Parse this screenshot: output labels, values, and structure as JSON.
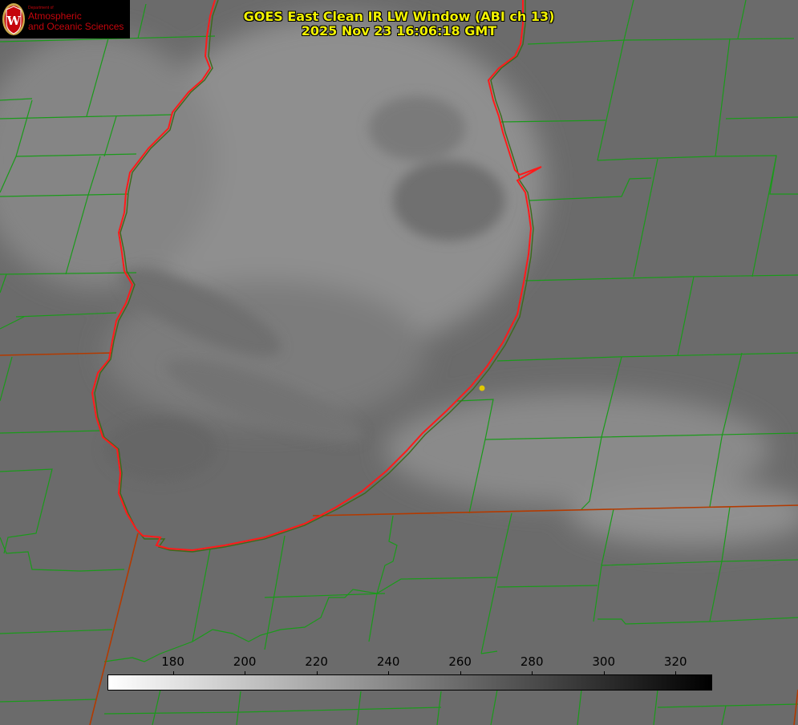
{
  "title": {
    "line1": "GOES East Clean IR LW Window (ABI ch 13)",
    "line2": "2025 Nov 23 16:06:18 GMT"
  },
  "logo": {
    "seal_letter": "W",
    "dept": "Department of",
    "line1": "Atmospheric",
    "line2": "and Oceanic Sciences"
  },
  "colors": {
    "title_text": "#f2f200",
    "county_lines": "#1a9a1a",
    "state_lines": "#b33a00",
    "coastline": "#ff1a1a",
    "marker": "#e0c800",
    "logo_red": "#c5050c"
  },
  "colorbar": {
    "min": 162,
    "max": 330,
    "ticks": [
      180,
      200,
      220,
      240,
      260,
      280,
      300,
      320
    ],
    "tick_labels": [
      "180",
      "200",
      "220",
      "240",
      "260",
      "280",
      "300",
      "320"
    ]
  }
}
